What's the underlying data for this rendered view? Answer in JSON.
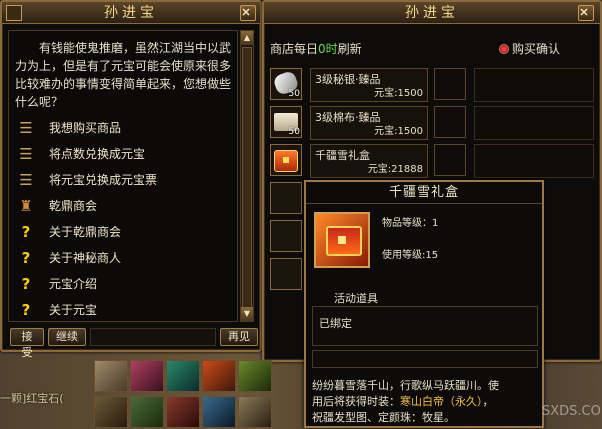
{
  "npc_dialog": {
    "title": "孙进宝",
    "intro": "有钱能使鬼推磨，虽然江湖当中以武力为上，但是有了元宝可能会使原来很多比较难办的事情变得简单起来，您想做些什么呢？",
    "options": [
      {
        "label": "我想购买商品",
        "icon": "scroll-icon"
      },
      {
        "label": "将点数兑换成元宝",
        "icon": "scroll-icon"
      },
      {
        "label": "将元宝兑换成元宝票",
        "icon": "scroll-icon"
      },
      {
        "label": "乾鼎商会",
        "icon": "bag-icon"
      },
      {
        "label": "关于乾鼎商会",
        "icon": "question-icon"
      },
      {
        "label": "关于神秘商人",
        "icon": "question-icon"
      },
      {
        "label": "元宝介绍",
        "icon": "question-icon"
      },
      {
        "label": "关于元宝",
        "icon": "question-icon"
      }
    ],
    "buttons": {
      "accept": "接受",
      "continue": "继续",
      "bye": "再见"
    }
  },
  "shop": {
    "title": "孙进宝",
    "refresh_prefix": "商店每日",
    "refresh_hour": "0时",
    "refresh_suffix": "刷新",
    "confirm_label": "购买确认",
    "items": [
      {
        "name": "3级秘银·臻品",
        "price": "元宝:1500",
        "count": "50",
        "icon": "silver-ore-icon"
      },
      {
        "name": "3级棉布·臻品",
        "price": "元宝:1500",
        "count": "50",
        "icon": "cloth-icon"
      },
      {
        "name": "千疆雪礼盒",
        "price": "元宝:21888",
        "count": "",
        "icon": "gift-box-icon"
      }
    ]
  },
  "tooltip": {
    "title": "千疆雪礼盒",
    "item_level": "物品等级：1",
    "use_level": "使用等级:15",
    "type": "活动道具",
    "bound": "已绑定",
    "desc_line1": "纷纷暮雪落千山，行歌纵马跃疆川。使",
    "desc_line2_prefix": "用后将获得时装：",
    "desc_line2_gold": "寒山白帝（永久）",
    "desc_line2_suffix": "，",
    "desc_line3": "祝疆发型图、定颜珠：牧星。"
  },
  "chat": {
    "line": "一颗]红宝石("
  },
  "watermark": "SXDS.COM",
  "colors": {
    "frame": "#8a6a3a",
    "title": "#f2d58a",
    "green": "#6cd65a",
    "gold": "#f0c040"
  }
}
